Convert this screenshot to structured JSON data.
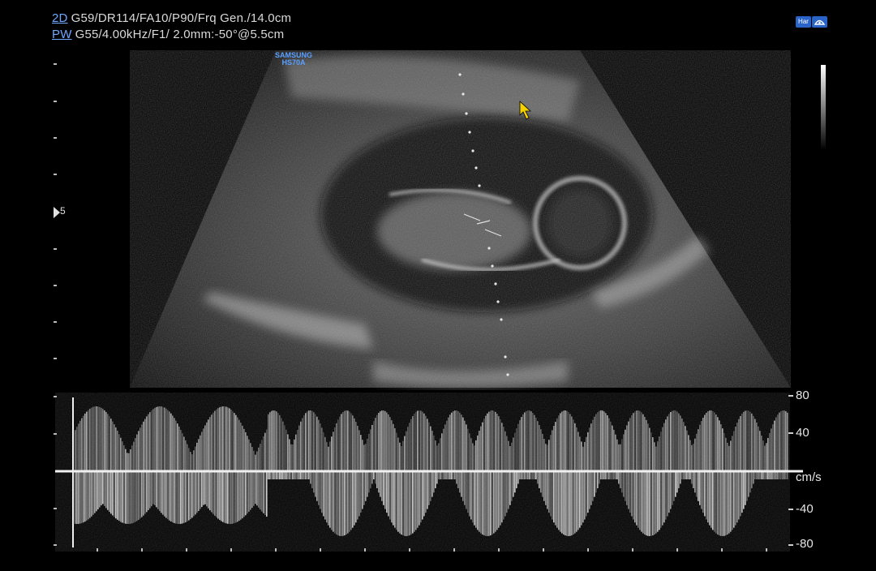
{
  "header": {
    "line1_mode": "2D",
    "line1_params": "G59/DR114/FA10/P90/Frq Gen./14.0cm",
    "line2_mode": "PW",
    "line2_params": "G55/4.00kHz/F1/ 2.0mm:-50°@5.5cm"
  },
  "brand": {
    "line1": "SAMSUNG",
    "line2": "HS70A"
  },
  "top_right": {
    "icon_label": "Har"
  },
  "focus_marker": "5",
  "doppler": {
    "scale_labels": [
      "80",
      "40",
      "cm/s",
      "-40",
      "-80"
    ]
  },
  "colors": {
    "accent_blue": "#2a64c8",
    "text": "#d9d9d9",
    "cursor": "#f5d000"
  }
}
